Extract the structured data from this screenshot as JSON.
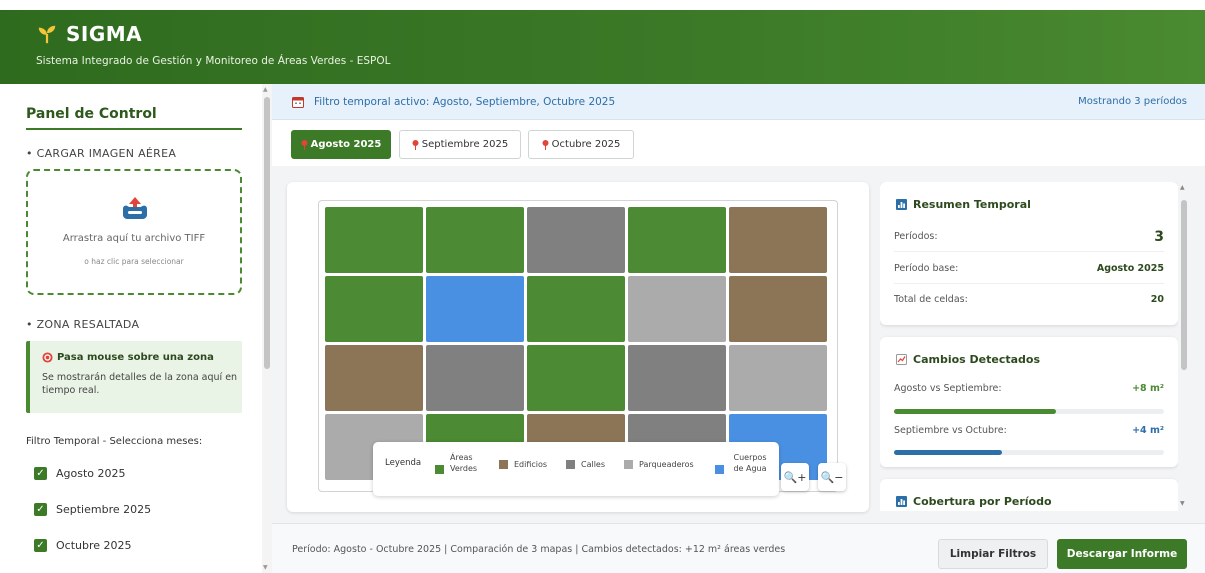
{
  "header": {
    "title": "SIGMA",
    "subtitle": "Sistema Integrado de Gestión y Monitoreo de Áreas Verdes - ESPOL",
    "logo_icon": "sprout-icon"
  },
  "sidebar": {
    "panel_title": "Panel de Control",
    "upload_section": "• CARGAR IMAGEN AÉREA",
    "upload_main": "Arrastra aquí tu archivo TIFF",
    "upload_sub": "o haz clic para seleccionar",
    "zone_section": "• ZONA RESALTADA",
    "zone_title": "Pasa mouse sobre una zona",
    "zone_desc": "Se mostrarán detalles de la zona aquí en tiempo real.",
    "filter_title": "Filtro Temporal - Selecciona meses:",
    "months": [
      {
        "label": "Agosto 2025",
        "checked": true
      },
      {
        "label": "Septiembre 2025",
        "checked": true
      },
      {
        "label": "Octubre 2025",
        "checked": true
      }
    ]
  },
  "filter_bar": {
    "text": "Filtro temporal activo: Agosto, Septiembre, Octubre 2025",
    "count": "Mostrando 3 períodos"
  },
  "tabs": [
    {
      "label": "Agosto 2025",
      "active": true
    },
    {
      "label": "Septiembre 2025",
      "active": false
    },
    {
      "label": "Octubre 2025",
      "active": false
    }
  ],
  "map": {
    "grid": [
      [
        "green",
        "green",
        "street",
        "green",
        "building"
      ],
      [
        "green",
        "water",
        "green",
        "parking",
        "building"
      ],
      [
        "building",
        "street",
        "green",
        "street",
        "parking"
      ],
      [
        "parking",
        "green",
        "building",
        "street",
        "water"
      ]
    ],
    "colors": {
      "green": "#4c8a34",
      "building": "#8b7556",
      "street": "#808080",
      "parking": "#ababab",
      "water": "#4a90e2"
    },
    "legend_title": "Leyenda",
    "legend": {
      "green": "Áreas Verdes",
      "building": "Edificios",
      "street": "Calles",
      "parking": "Parqueaderos",
      "water": "Cuerpos de Agua"
    },
    "zoom_in": "+",
    "zoom_out": "−"
  },
  "summary": {
    "title": "Resumen Temporal",
    "rows": [
      {
        "label": "Períodos:",
        "value": "3"
      },
      {
        "label": "Período base:",
        "value": "Agosto 2025"
      },
      {
        "label": "Total de celdas:",
        "value": "20"
      }
    ]
  },
  "changes": {
    "title": "Cambios Detectados",
    "items": [
      {
        "label": "Agosto vs Septiembre:",
        "value": "+8 m²",
        "progress": 0.6,
        "color": "#4a8a30"
      },
      {
        "label": "Septiembre vs Octubre:",
        "value": "+4 m²",
        "progress": 0.4,
        "color": "#2c6ea8"
      }
    ]
  },
  "coverage": {
    "title": "Cobertura por Período"
  },
  "footer": {
    "summary": "Período: Agosto - Octubre 2025 | Comparación de 3 mapas | Cambios detectados: +12 m² áreas verdes",
    "clear_label": "Limpiar Filtros",
    "download_label": "Descargar Informe"
  }
}
